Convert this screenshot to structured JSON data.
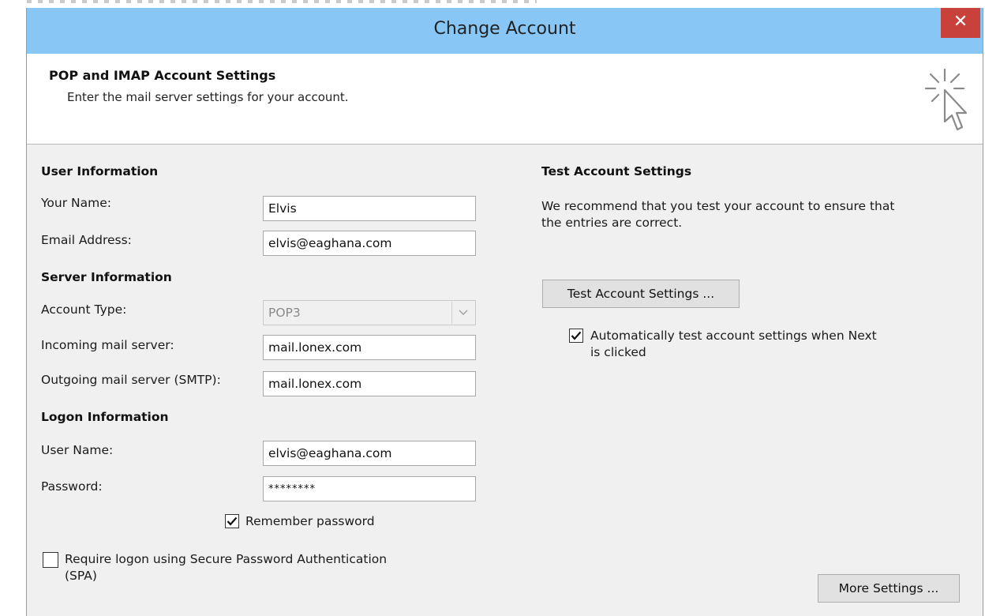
{
  "window": {
    "title": "Change Account",
    "close_glyph": "✕"
  },
  "header": {
    "heading": "POP and IMAP Account Settings",
    "subtitle": "Enter the mail server settings for your account."
  },
  "user_info": {
    "section_title": "User Information",
    "your_name_label": "Your Name:",
    "your_name_value": "Elvis",
    "email_label": "Email Address:",
    "email_value": "elvis@eaghana.com"
  },
  "server_info": {
    "section_title": "Server Information",
    "account_type_label": "Account Type:",
    "account_type_value": "POP3",
    "incoming_label": "Incoming mail server:",
    "incoming_value": "mail.lonex.com",
    "outgoing_label": "Outgoing mail server (SMTP):",
    "outgoing_value": "mail.lonex.com"
  },
  "logon_info": {
    "section_title": "Logon Information",
    "username_label": "User Name:",
    "username_value": "elvis@eaghana.com",
    "password_label": "Password:",
    "password_value": "********",
    "remember_label": "Remember password",
    "remember_checked": true,
    "spa_label_line1": "Require logon using Secure Password Authentication",
    "spa_label_line2": "(SPA)",
    "spa_checked": false
  },
  "test_settings": {
    "section_title": "Test Account Settings",
    "description_line1": "We recommend that you test your account to ensure that",
    "description_line2": "the entries are correct.",
    "test_button_label": "Test Account Settings ...",
    "auto_test_line1": "Automatically test account settings when Next",
    "auto_test_line2": "is clicked",
    "auto_test_checked": true
  },
  "more_settings_button_label": "More Settings ...",
  "colors": {
    "titlebar": "#88c7f5",
    "close_button": "#c8413a",
    "dialog_bg": "#f0f0f0"
  },
  "icons": {
    "close": "close-icon",
    "wizard": "wizard-cursor-icon",
    "dropdown": "chevron-down-icon",
    "check": "checkmark-icon"
  }
}
